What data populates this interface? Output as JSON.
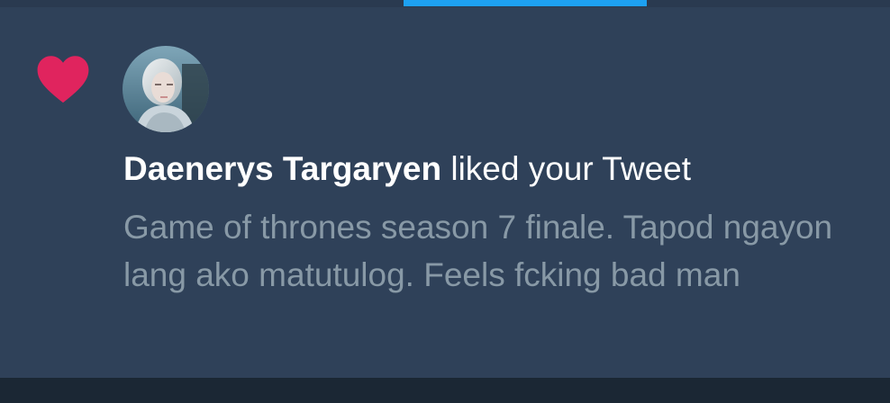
{
  "colors": {
    "background": "#2f4159",
    "accent": "#1da1f2",
    "like": "#e0245e",
    "text_primary": "#ffffff",
    "text_secondary": "#8899a6"
  },
  "tabs": {
    "active_indicator": "active-tab-indicator"
  },
  "notification": {
    "icon": "heart-icon",
    "avatar": "user-avatar",
    "user_name": "Daenerys Targaryen",
    "action_text": "liked your Tweet",
    "tweet_text": "Game of thrones season 7 finale. Tapod ngayon lang ako matutulog. Feels fcking bad man"
  }
}
